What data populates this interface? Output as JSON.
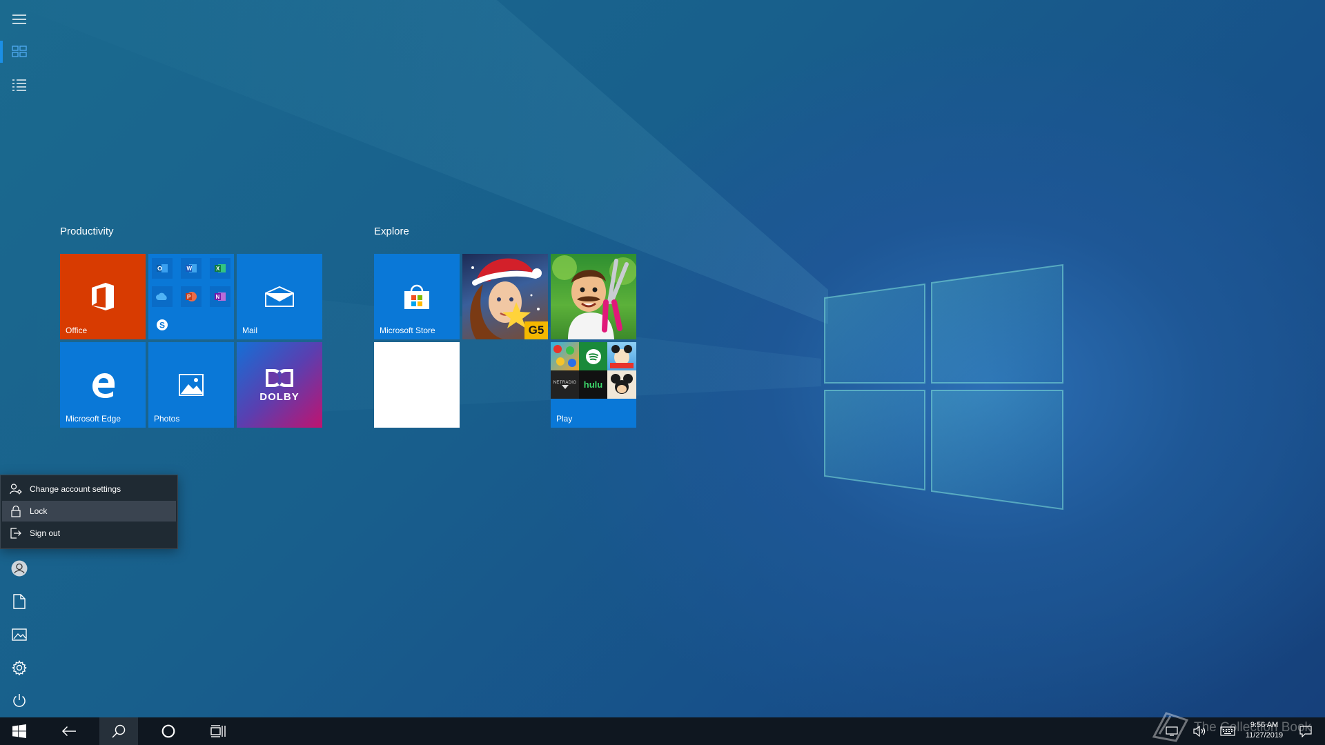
{
  "groups": {
    "productivity": {
      "title": "Productivity",
      "tiles": {
        "office": "Office",
        "mail": "Mail",
        "edge": "Microsoft Edge",
        "photos": "Photos",
        "dolby": "DOLBY"
      }
    },
    "explore": {
      "title": "Explore",
      "tiles": {
        "store": "Microsoft Store",
        "play": "Play",
        "g5_badge": "G5",
        "hulu": "hulu",
        "netflix_mini": "NETRADIO"
      }
    }
  },
  "account_menu": {
    "items": [
      "Change account settings",
      "Lock",
      "Sign out"
    ],
    "highlighted": "Lock"
  },
  "taskbar": {
    "time": "9:56 AM",
    "date": "11/27/2019"
  },
  "watermark": "The Collection Book",
  "colors": {
    "office": "#d83b01",
    "tile_blue": "#0a78d7",
    "accent": "#1b8fe6",
    "taskbar": "#0f1720",
    "flyout": "#1f2a33"
  }
}
